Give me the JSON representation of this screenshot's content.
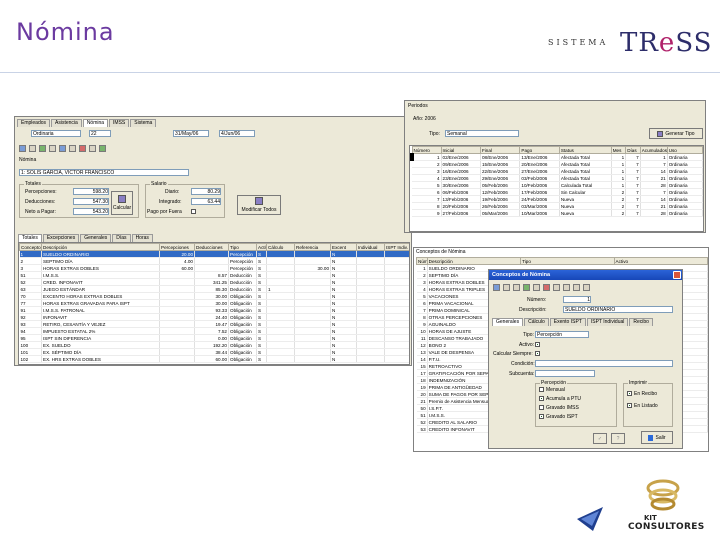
{
  "slide": {
    "title": "Nómina"
  },
  "brand": {
    "sistema": "SISTEMA",
    "tress_pre": "TR",
    "tress_accent": "e",
    "tress_post": "SS",
    "kit": "KIT",
    "consultores": "CONSULTORES"
  },
  "employee_window": {
    "tabs": [
      "Empleados",
      "Asistencia",
      "Nómina",
      "IMSS",
      "Sistema"
    ],
    "periodo_label": "Ordinaria",
    "periodo_num": "22",
    "fecha_inicio": "31/May/06",
    "fecha_fin": "4/Jun/06",
    "nomina_label": "Nómina",
    "employee_line": "1: SOLÍS GARCÍA, VÍCTOR FRANCISCO",
    "totals": {
      "title": "Totales",
      "percepciones_label": "Percepciones:",
      "percepciones": "598.20",
      "deducciones_label": "Deducciones:",
      "deducciones": "547.30",
      "neto_label": "Neto a Pagar:",
      "neto": "543.20"
    },
    "calculate_button": "Calcular",
    "salario": {
      "title": "Salario",
      "diario_label": "Diario:",
      "diario": "80.29",
      "integrado_label": "Integrado:",
      "integrado": "63.44",
      "fuera_label": "Pago por Fuera"
    },
    "modify_button": "Modificar Todos",
    "subtabs": [
      "Totales",
      "Excepciones",
      "Generales",
      "Días",
      "Horas"
    ],
    "columns": [
      "Concepto",
      "Descripción",
      "Percepciones",
      "Deducciones",
      "Tipo",
      "Activo",
      "Cálculo",
      "Referencia",
      "Excent",
      "Individual",
      "ISPT Indiv."
    ],
    "rows": [
      {
        "c": "1",
        "d": "SUELDO ORDINARIO",
        "p": "20.00",
        "dd": "",
        "t": "Percepción",
        "a": "S",
        "ca": "",
        "r": "",
        "e": "N",
        "sel": true
      },
      {
        "c": "2",
        "d": "SEPTIMO DÍA",
        "p": "4.00",
        "dd": "",
        "t": "Percepción",
        "a": "S",
        "ca": "",
        "r": "",
        "e": "N",
        "sel": false
      },
      {
        "c": "3",
        "d": "HORAS EXTRAS DOBLES",
        "p": "60.00",
        "dd": "",
        "t": "Percepción",
        "a": "S",
        "ca": "",
        "r": "30.00",
        "e": "N",
        "sel": false
      },
      {
        "c": "51",
        "d": "I.M.S.S.",
        "p": "",
        "dd": "8.57",
        "t": "Deducción",
        "a": "S",
        "ca": "",
        "r": "",
        "e": "N",
        "sel": false
      },
      {
        "c": "52",
        "d": "CRED. INFONAVIT",
        "p": "",
        "dd": "341.25",
        "t": "Deducción",
        "a": "S",
        "ca": "",
        "r": "",
        "e": "N",
        "sel": false
      },
      {
        "c": "63",
        "d": "JUEGO ESTÁNDAR",
        "p": "",
        "dd": "85.30",
        "t": "Deducción",
        "a": "S",
        "ca": "1",
        "r": "",
        "e": "N",
        "sel": false
      },
      {
        "c": "70",
        "d": "EXCENTO HORAS EXTRAS DOBLES",
        "p": "",
        "dd": "30.00",
        "t": "Obligación",
        "a": "S",
        "ca": "",
        "r": "",
        "e": "N",
        "sel": false
      },
      {
        "c": "77",
        "d": "HORAS EXTRAS GRAVADAS PARA ISPT",
        "p": "",
        "dd": "30.00",
        "t": "Obligación",
        "a": "S",
        "ca": "",
        "r": "",
        "e": "N",
        "sel": false
      },
      {
        "c": "91",
        "d": "I.M.S.S. PATRONAL",
        "p": "",
        "dd": "93.33",
        "t": "Obligación",
        "a": "S",
        "ca": "",
        "r": "",
        "e": "N",
        "sel": false
      },
      {
        "c": "92",
        "d": "INFONAVIT",
        "p": "",
        "dd": "24.40",
        "t": "Obligación",
        "a": "S",
        "ca": "",
        "r": "",
        "e": "N",
        "sel": false
      },
      {
        "c": "93",
        "d": "RETIRO, CESANTÍA Y VEJEZ",
        "p": "",
        "dd": "19.47",
        "t": "Obligación",
        "a": "S",
        "ca": "",
        "r": "",
        "e": "N",
        "sel": false
      },
      {
        "c": "94",
        "d": "IMPUESTO ESTATAL 2%",
        "p": "",
        "dd": "7.52",
        "t": "Obligación",
        "a": "S",
        "ca": "",
        "r": "",
        "e": "N",
        "sel": false
      },
      {
        "c": "95",
        "d": "ISPT SIN DIFERENCIA",
        "p": "",
        "dd": "0.00",
        "t": "Obligación",
        "a": "S",
        "ca": "",
        "r": "",
        "e": "N",
        "sel": false
      },
      {
        "c": "100",
        "d": "EX. SUELDO",
        "p": "",
        "dd": "192.20",
        "t": "Obligación",
        "a": "S",
        "ca": "",
        "r": "",
        "e": "N",
        "sel": false
      },
      {
        "c": "101",
        "d": "EX. SÉPTIMO DÍA",
        "p": "",
        "dd": "38.44",
        "t": "Obligación",
        "a": "S",
        "ca": "",
        "r": "",
        "e": "N",
        "sel": false
      },
      {
        "c": "102",
        "d": "EX. HRS EXTRAS DOBLES",
        "p": "",
        "dd": "60.00",
        "t": "Obligación",
        "a": "S",
        "ca": "",
        "r": "",
        "e": "N",
        "sel": false
      }
    ]
  },
  "periods_window": {
    "title": "Periodos",
    "year": "Año: 2006",
    "tipo_label": "Tipo:",
    "tipo_value": "Semanal",
    "create_button": "Generar Tipo",
    "columns": [
      "Número",
      "Inicial",
      "Final",
      "Pago",
      "Status",
      "Mes",
      "Días",
      "Acumulados",
      "Uso"
    ],
    "rows": [
      {
        "n": "1",
        "i": "02/Ene/2006",
        "f": "08/Ene/2006",
        "p": "13/Ene/2006",
        "s": "Afectada Total",
        "m": "1",
        "d": "7",
        "a": "1",
        "u": "Ordinaria",
        "sel": true
      },
      {
        "n": "2",
        "i": "09/Ene/2006",
        "f": "15/Ene/2006",
        "p": "20/Ene/2006",
        "s": "Afectada Total",
        "m": "1",
        "d": "7",
        "a": "7",
        "u": "Ordinaria",
        "sel": false
      },
      {
        "n": "3",
        "i": "16/Ene/2006",
        "f": "22/Ene/2006",
        "p": "27/Ene/2006",
        "s": "Afectada Total",
        "m": "1",
        "d": "7",
        "a": "14",
        "u": "Ordinaria",
        "sel": false
      },
      {
        "n": "4",
        "i": "23/Ene/2006",
        "f": "29/Ene/2006",
        "p": "03/Feb/2006",
        "s": "Afectada Total",
        "m": "1",
        "d": "7",
        "a": "21",
        "u": "Ordinaria",
        "sel": false
      },
      {
        "n": "5",
        "i": "30/Ene/2006",
        "f": "05/Feb/2006",
        "p": "10/Feb/2006",
        "s": "Calculada Total",
        "m": "1",
        "d": "7",
        "a": "28",
        "u": "Ordinaria",
        "sel": false
      },
      {
        "n": "6",
        "i": "06/Feb/2006",
        "f": "12/Feb/2006",
        "p": "17/Feb/2006",
        "s": "Sin Calcular",
        "m": "2",
        "d": "7",
        "a": "7",
        "u": "Ordinaria",
        "sel": false
      },
      {
        "n": "7",
        "i": "13/Feb/2006",
        "f": "19/Feb/2006",
        "p": "24/Feb/2006",
        "s": "Nueva",
        "m": "2",
        "d": "7",
        "a": "14",
        "u": "Ordinaria",
        "sel": false
      },
      {
        "n": "8",
        "i": "20/Feb/2006",
        "f": "26/Feb/2006",
        "p": "03/Mar/2006",
        "s": "Nueva",
        "m": "2",
        "d": "7",
        "a": "21",
        "u": "Ordinaria",
        "sel": false
      },
      {
        "n": "9",
        "i": "27/Feb/2006",
        "f": "05/Mar/2006",
        "p": "10/Mar/2006",
        "s": "Nueva",
        "m": "2",
        "d": "7",
        "a": "28",
        "u": "Ordinaria",
        "sel": false
      }
    ]
  },
  "concepts_list_window": {
    "title": "Conceptos de Nómina",
    "columns": [
      "Número",
      "Descripción",
      "Tipo",
      "Activo"
    ],
    "rows": [
      {
        "n": "1",
        "d": "SUELDO ORDINARIO"
      },
      {
        "n": "2",
        "d": "SEPTIMO DÍA"
      },
      {
        "n": "3",
        "d": "HORAS EXTRAS DOBLES"
      },
      {
        "n": "4",
        "d": "HORAS EXTRAS TRIPLES"
      },
      {
        "n": "5",
        "d": "VACACIONES"
      },
      {
        "n": "6",
        "d": "PRIMA VACACIONAL"
      },
      {
        "n": "7",
        "d": "PRIMA DOMINICAL"
      },
      {
        "n": "8",
        "d": "OTRAS PERCEPCIONES"
      },
      {
        "n": "9",
        "d": "AGUINALDO"
      },
      {
        "n": "10",
        "d": "HORAS DE AJUSTE"
      },
      {
        "n": "11",
        "d": "DESCANSO TRABAJADO"
      },
      {
        "n": "12",
        "d": "BONO 2"
      },
      {
        "n": "13",
        "d": "VALE DE DESPENSA"
      },
      {
        "n": "14",
        "d": "P.T.U."
      },
      {
        "n": "15",
        "d": "RETROACTIVO"
      },
      {
        "n": "17",
        "d": "GRATIFICACIÓN POR SEPAR."
      },
      {
        "n": "18",
        "d": "INDEMNIZACIÓN"
      },
      {
        "n": "19",
        "d": "PRIMA DE ANTIGÜEDAD"
      },
      {
        "n": "20",
        "d": "SUMA DE PAGOS POR SEPAR."
      },
      {
        "n": "21",
        "d": "Premio de Asistencia Mensual"
      },
      {
        "n": "50",
        "d": "I.S.P.T."
      },
      {
        "n": "51",
        "d": "I.M.S.S."
      },
      {
        "n": "52",
        "d": "CREDITO AL SALARIO"
      },
      {
        "n": "53",
        "d": "CREDITO INFONAVIT"
      }
    ]
  },
  "concept_dialog": {
    "title": "Conceptos de Nómina",
    "numero_label": "Número:",
    "numero": "1",
    "descripcion_label": "Descripción:",
    "descripcion": "SUELDO ORDINARIO",
    "tabs": [
      "Generales",
      "Cálculo",
      "Exento ISPT",
      "ISPT Individual",
      "Recibo"
    ],
    "tipo_label": "Tipo:",
    "tipo": "Percepción",
    "activo_label": "Activo:",
    "calcular_label": "Calcular Siempre:",
    "condicion_label": "Condición:",
    "subcuenta_label": "Subcuenta:",
    "percepcion_group": "Percepción",
    "imprimir_group": "Imprimir",
    "checks_left": [
      "Mensual",
      "Acumula a PTU",
      "Gravado IMSS",
      "Gravado ISPT"
    ],
    "checks_right": [
      "En Recibo",
      "En Listado"
    ],
    "exit_button": "Salir"
  }
}
